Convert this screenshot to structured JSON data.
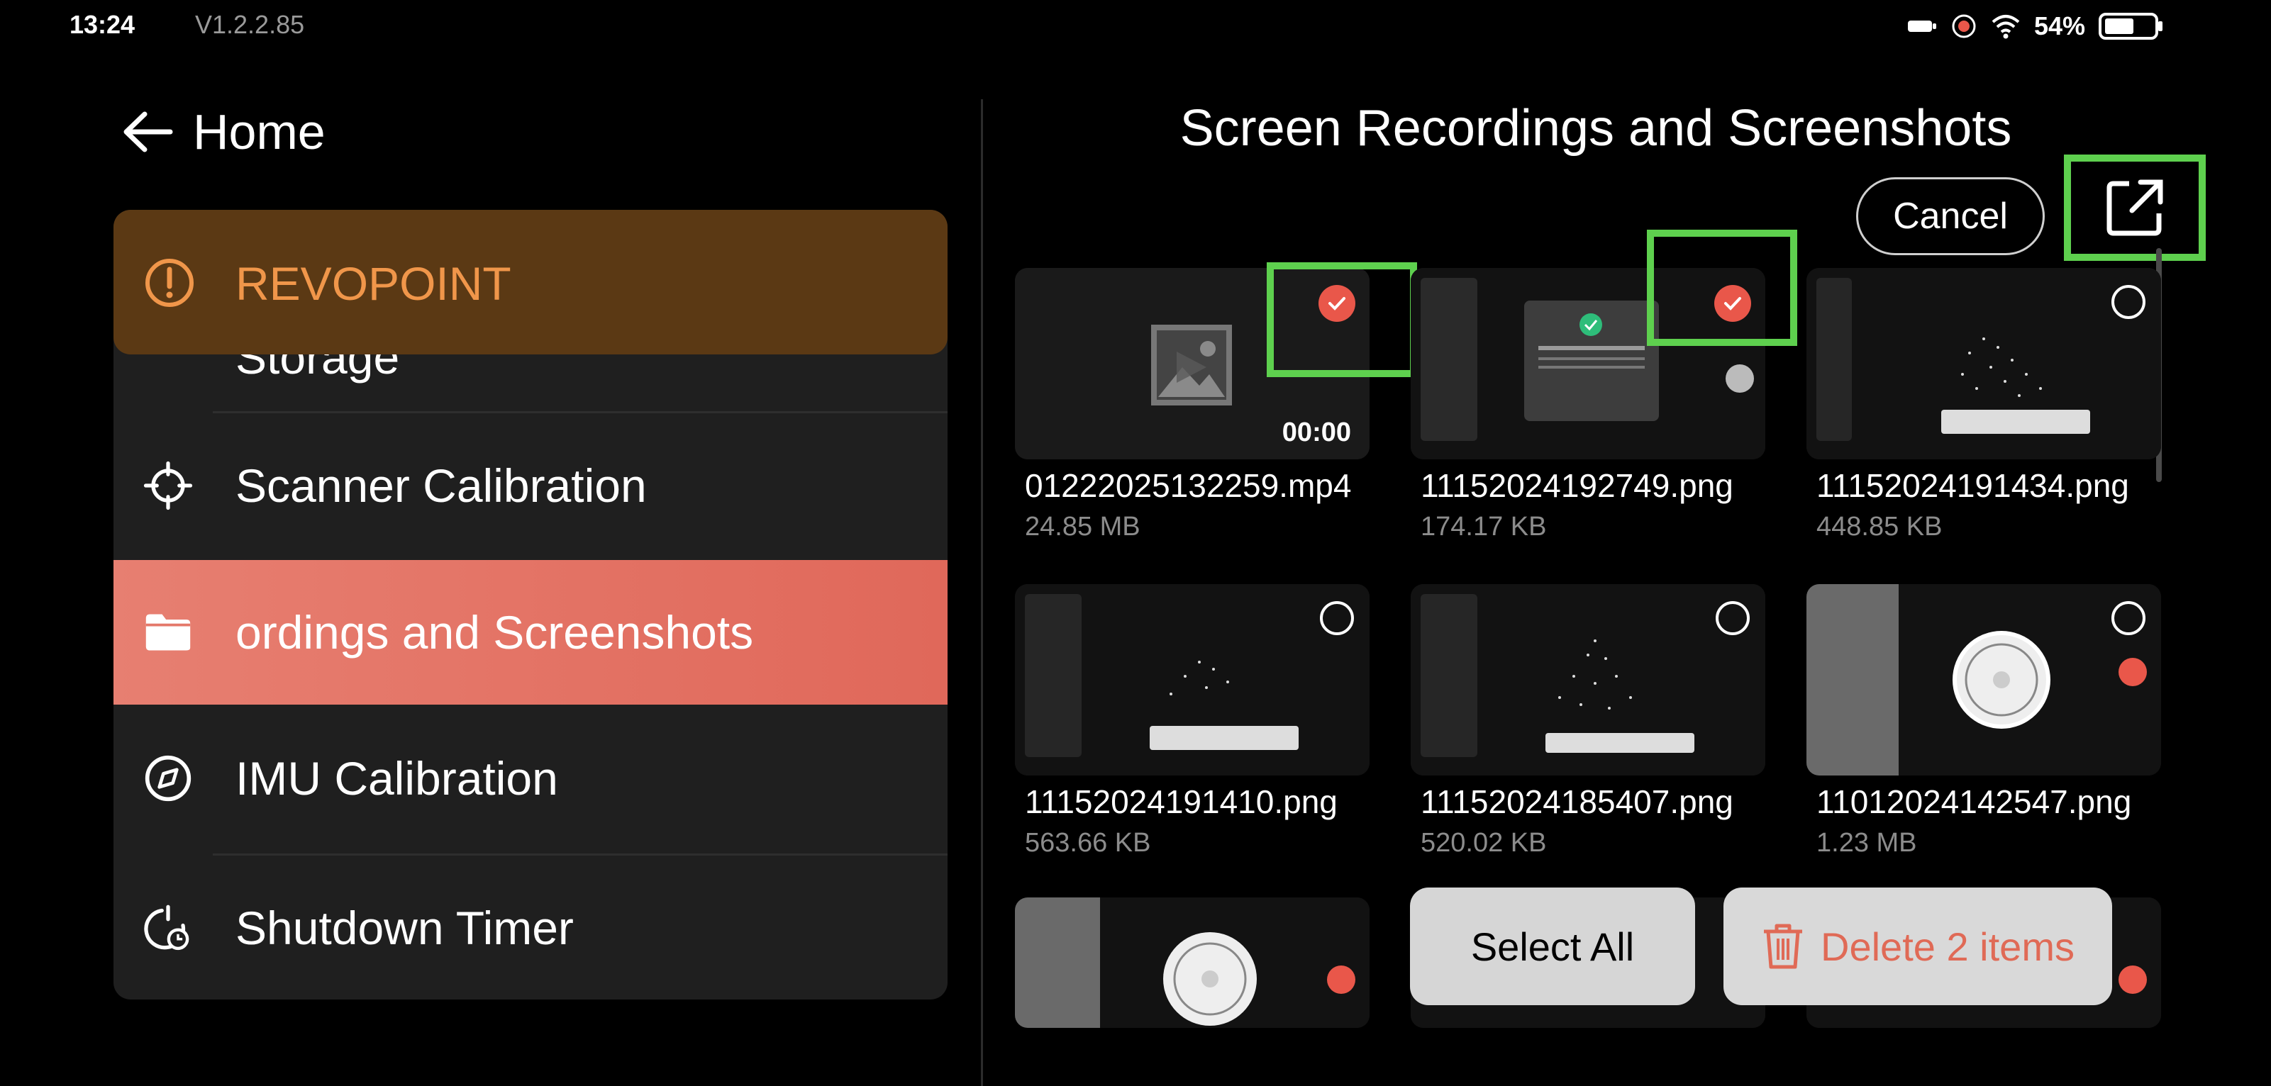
{
  "status_bar": {
    "time": "13:24",
    "version": "V1.2.2.85",
    "battery_percent": "54%",
    "icons": [
      "battery-saver-icon",
      "record-icon",
      "wifi-icon",
      "battery-icon"
    ]
  },
  "left_panel": {
    "back_title": "Home",
    "toast": {
      "label": "REVOPOINT",
      "icon": "alert-circle-icon",
      "color": "#f0964a"
    },
    "hidden_item_label": "Storage",
    "menu": [
      {
        "label": "Scanner Calibration",
        "icon": "crosshair-icon",
        "active": false
      },
      {
        "label": "ordings and Screenshots",
        "icon": "folder-icon",
        "active": true
      },
      {
        "label": "IMU Calibration",
        "icon": "compass-icon",
        "active": false
      },
      {
        "label": "Shutdown Timer",
        "icon": "timer-icon",
        "active": false
      }
    ]
  },
  "right_panel": {
    "title": "Screen Recordings and Screenshots",
    "cancel_label": "Cancel",
    "files": [
      {
        "name": "01222025132259.mp4",
        "size": "24.85 MB",
        "selected": true,
        "duration": "00:00",
        "kind": "video"
      },
      {
        "name": "11152024192749.png",
        "size": "174.17 KB",
        "selected": true,
        "kind": "dialog"
      },
      {
        "name": "11152024191434.png",
        "size": "448.85 KB",
        "selected": false,
        "kind": "dots"
      },
      {
        "name": "11152024191410.png",
        "size": "563.66 KB",
        "selected": false,
        "kind": "dots"
      },
      {
        "name": "11152024185407.png",
        "size": "520.02 KB",
        "selected": false,
        "kind": "dots"
      },
      {
        "name": "11012024142547.png",
        "size": "1.23 MB",
        "selected": false,
        "kind": "fan"
      },
      {
        "name": "",
        "size": "",
        "selected": false,
        "kind": "fan"
      },
      {
        "name": "",
        "size": "",
        "selected": false,
        "kind": "dots"
      },
      {
        "name": "",
        "size": "",
        "selected": false,
        "kind": "fan"
      }
    ],
    "select_all_label": "Select All",
    "delete_label": "Delete 2 items"
  },
  "colors": {
    "accent_active": "#e0685a",
    "highlight": "#5ed04e",
    "checked": "#e9574a",
    "delete_text": "#e06a56"
  }
}
